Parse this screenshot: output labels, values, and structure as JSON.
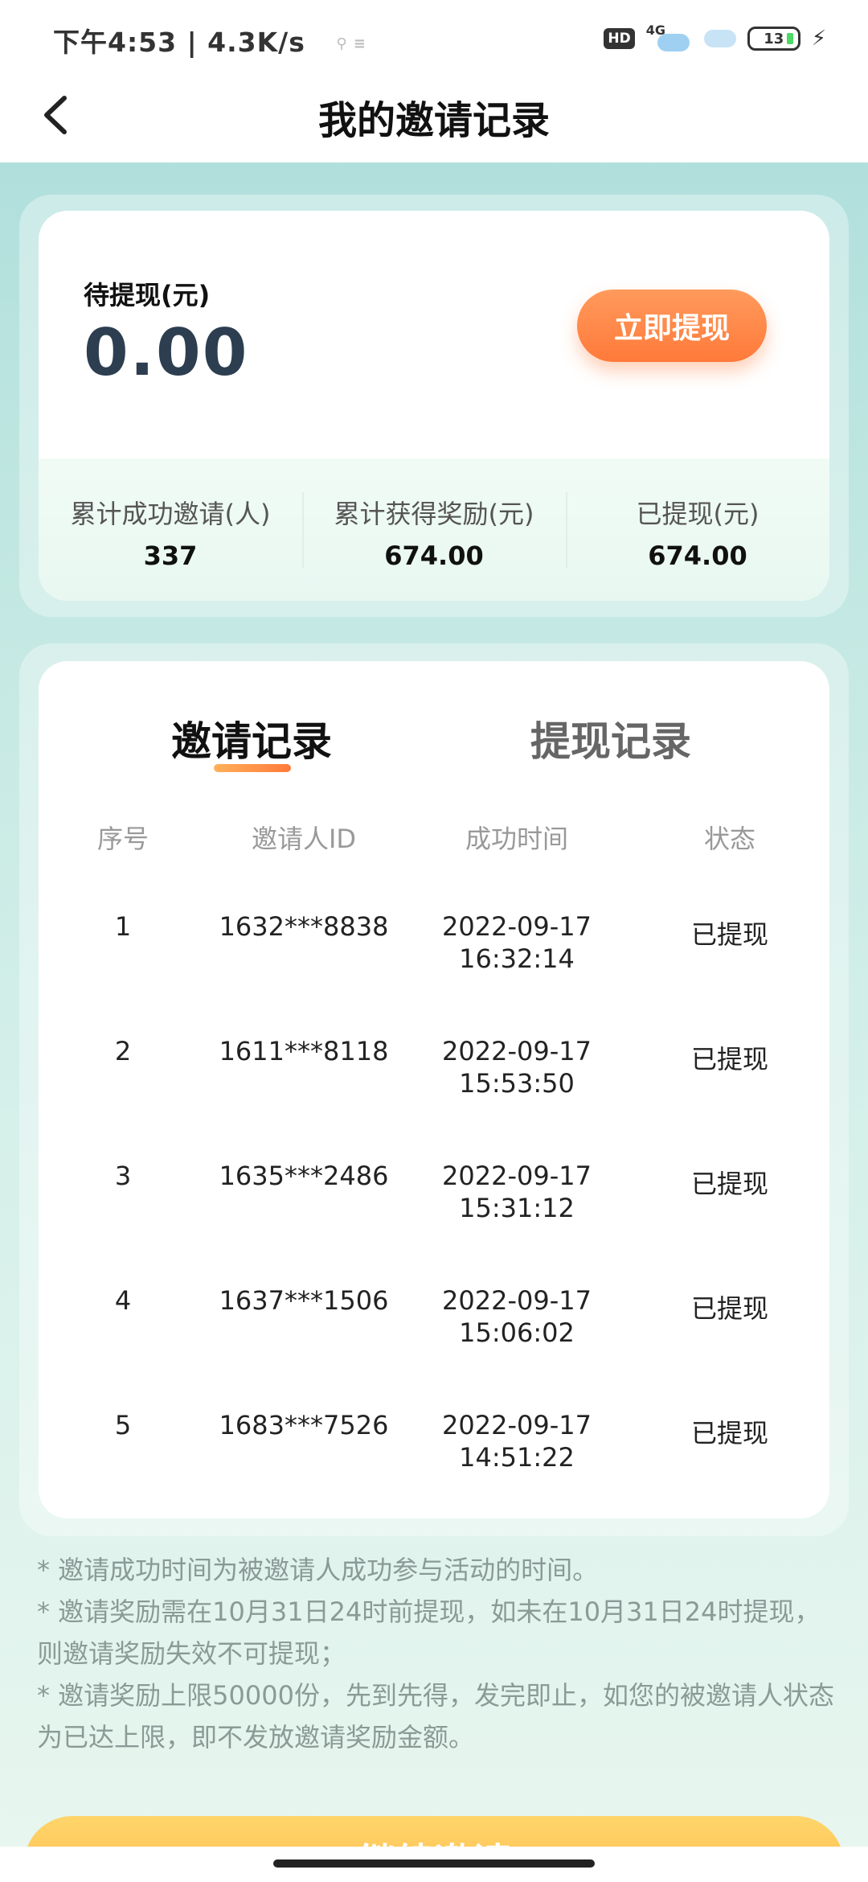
{
  "status_bar": {
    "time_speed": "下午4:53 | 4.3K/s",
    "hd": "HD",
    "network": "4G",
    "battery": "13"
  },
  "header": {
    "title": "我的邀请记录"
  },
  "summary": {
    "pending_label": "待提现(元)",
    "pending_amount": "0.00",
    "withdraw_button": "立即提现",
    "stats": [
      {
        "label": "累计成功邀请(人)",
        "value": "337"
      },
      {
        "label": "累计获得奖励(元)",
        "value": "674.00"
      },
      {
        "label": "已提现(元)",
        "value": "674.00"
      }
    ]
  },
  "records": {
    "tabs": [
      {
        "label": "邀请记录",
        "active": true
      },
      {
        "label": "提现记录",
        "active": false
      }
    ],
    "columns": [
      "序号",
      "邀请人ID",
      "成功时间",
      "状态"
    ],
    "rows": [
      {
        "seq": "1",
        "id": "1632***8838",
        "date": "2022-09-17",
        "time": "16:32:14",
        "status": "已提现"
      },
      {
        "seq": "2",
        "id": "1611***8118",
        "date": "2022-09-17",
        "time": "15:53:50",
        "status": "已提现"
      },
      {
        "seq": "3",
        "id": "1635***2486",
        "date": "2022-09-17",
        "time": "15:31:12",
        "status": "已提现"
      },
      {
        "seq": "4",
        "id": "1637***1506",
        "date": "2022-09-17",
        "time": "15:06:02",
        "status": "已提现"
      },
      {
        "seq": "5",
        "id": "1683***7526",
        "date": "2022-09-17",
        "time": "14:51:22",
        "status": "已提现"
      }
    ]
  },
  "notes": [
    "* 邀请成功时间为被邀请人成功参与活动的时间。",
    "* 邀请奖励需在10月31日24时前提现，如未在10月31日24时提现，则邀请奖励失效不可提现；",
    "* 邀请奖励上限50000份，先到先得，发完即止，如您的被邀请人状态为已达上限，即不发放邀请奖励金额。"
  ],
  "bottom_button": "继续邀请",
  "colors": {
    "accent_orange": "#ff7a3a",
    "amount_text": "#2c3e50",
    "background_teal": "#a9dcd9"
  }
}
